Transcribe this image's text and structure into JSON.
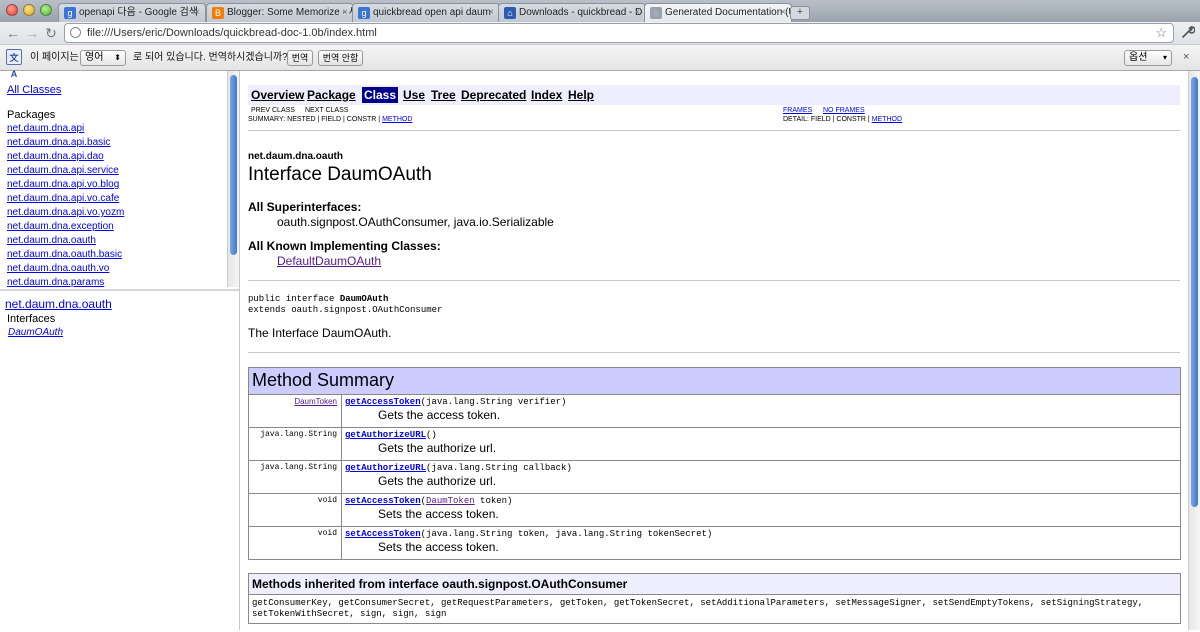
{
  "browser": {
    "tabs": [
      {
        "title": "openapi 다음 - Google 검색",
        "favicon_color": "#3b73d6",
        "favicon_glyph": "g"
      },
      {
        "title": "Blogger: Some Memorize - 새",
        "favicon_color": "#f57d00",
        "favicon_glyph": "B"
      },
      {
        "title": "quickbread open api daum",
        "favicon_color": "#3b73d6",
        "favicon_glyph": "g"
      },
      {
        "title": "Downloads - quickbread - D",
        "favicon_color": "#2a5db0",
        "favicon_glyph": "⌂"
      },
      {
        "title": "Generated Documentation (U",
        "favicon_color": "#9aa3ad",
        "favicon_glyph": "◌"
      }
    ],
    "tab_close_glyph": "×",
    "new_tab_glyph": "+",
    "url": "file:///Users/eric/Downloads/quickbread-doc-1.0b/index.html",
    "back_glyph": "←",
    "forward_glyph": "→",
    "reload_glyph": "↻",
    "star_glyph": "☆",
    "wrench_glyph": "🔧"
  },
  "translate_bar": {
    "icon_label": "文A",
    "prefix": "이 페이지는",
    "language": "영어",
    "middle": "로 되어 있습니다. 번역하시겠습니까?",
    "translate_button": "번역",
    "no_translate_button": "번역 안함",
    "options_button": "옵션",
    "close_glyph": "×"
  },
  "package_frame": {
    "all_classes": "All Classes",
    "packages_heading": "Packages",
    "packages": [
      "net.daum.dna.api",
      "net.daum.dna.api.basic",
      "net.daum.dna.api.dao",
      "net.daum.dna.api.service",
      "net.daum.dna.api.vo.blog",
      "net.daum.dna.api.vo.cafe",
      "net.daum.dna.api.vo.yozm",
      "net.daum.dna.exception",
      "net.daum.dna.oauth",
      "net.daum.dna.oauth.basic",
      "net.daum.dna.oauth.vo",
      "net.daum.dna.params"
    ]
  },
  "class_frame": {
    "package": "net.daum.dna.oauth",
    "interfaces_heading": "Interfaces",
    "interfaces": [
      "DaumOAuth"
    ]
  },
  "doc": {
    "nav": {
      "overview": "Overview",
      "package": "Package",
      "class": "Class",
      "use": "Use",
      "tree": "Tree",
      "deprecated": "Deprecated",
      "index": "Index",
      "help": "Help"
    },
    "prev_class": "PREV CLASS",
    "next_class": "NEXT CLASS",
    "frames": "FRAMES",
    "no_frames": "NO FRAMES",
    "summary_prefix": "SUMMARY: NESTED | FIELD | CONSTR |",
    "summary_method": "METHOD",
    "detail_prefix": "DETAIL: FIELD | CONSTR |",
    "detail_method": "METHOD",
    "package_name": "net.daum.dna.oauth",
    "title": "Interface DaumOAuth",
    "superinterfaces_heading": "All Superinterfaces:",
    "superinterfaces": "oauth.signpost.OAuthConsumer, java.io.Serializable",
    "implementing_heading": "All Known Implementing Classes:",
    "implementing": "DefaultDaumOAuth",
    "declaration_prefix": "public interface",
    "declaration_name": "DaumOAuth",
    "declaration_extends": "extends oauth.signpost.OAuthConsumer",
    "description": "The Interface DaumOAuth.",
    "method_summary": {
      "heading": "Method Summary",
      "rows": [
        {
          "type": "DaumToken",
          "type_link": true,
          "name": "getAccessToken",
          "params_pre": "(java.lang.String verifier)",
          "param_link": "",
          "params_post": "",
          "desc": "Gets the access token."
        },
        {
          "type": "java.lang.String",
          "type_link": false,
          "name": "getAuthorizeURL",
          "params_pre": "()",
          "param_link": "",
          "params_post": "",
          "desc": "Gets the authorize url."
        },
        {
          "type": "java.lang.String",
          "type_link": false,
          "name": "getAuthorizeURL",
          "params_pre": "(java.lang.String callback)",
          "param_link": "",
          "params_post": "",
          "desc": "Gets the authorize url."
        },
        {
          "type": "void",
          "type_link": false,
          "name": "setAccessToken",
          "params_pre": "(",
          "param_link": "DaumToken",
          "params_post": " token)",
          "desc": "Sets the access token."
        },
        {
          "type": "void",
          "type_link": false,
          "name": "setAccessToken",
          "params_pre": "(java.lang.String token, java.lang.String tokenSecret)",
          "param_link": "",
          "params_post": "",
          "desc": "Sets the access token."
        }
      ]
    },
    "inherited": {
      "heading": "Methods inherited from interface oauth.signpost.OAuthConsumer",
      "methods": "getConsumerKey, getConsumerSecret, getRequestParameters, getToken, getTokenSecret, setAdditionalParameters, setMessageSigner, setSendEmptyTokens, setSigningStrategy, setTokenWithSecret, sign, sign, sign"
    }
  }
}
